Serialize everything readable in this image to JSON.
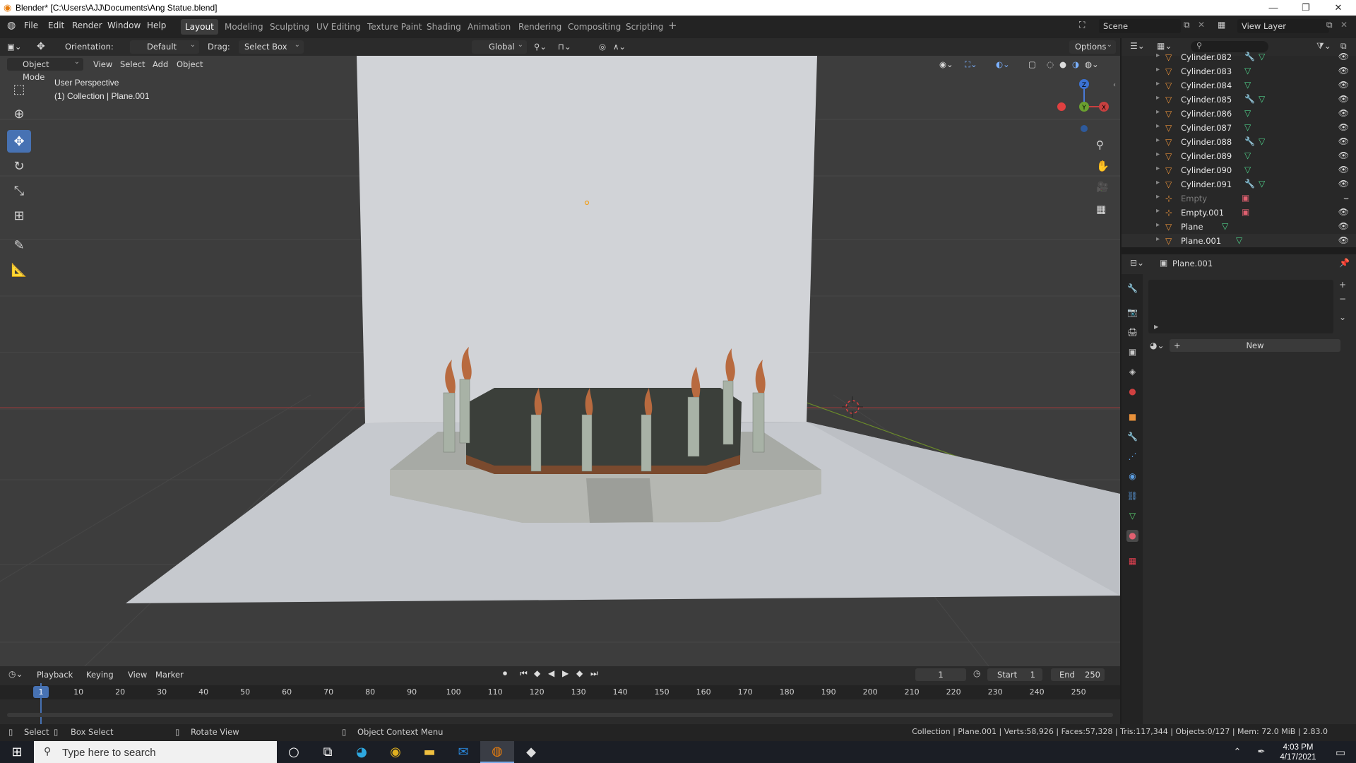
{
  "window": {
    "title": "Blender* [C:\\Users\\AJJ\\Documents\\Ang Statue.blend]"
  },
  "menu": [
    "File",
    "Edit",
    "Render",
    "Window",
    "Help"
  ],
  "workspaces": [
    "Layout",
    "Modeling",
    "Sculpting",
    "UV Editing",
    "Texture Paint",
    "Shading",
    "Animation",
    "Rendering",
    "Compositing",
    "Scripting"
  ],
  "scene": {
    "name": "Scene",
    "view_layer": "View Layer"
  },
  "toolsettings": {
    "orientation_label": "Orientation:",
    "orientation_value": "Default",
    "drag_label": "Drag:",
    "drag_value": "Select Box",
    "transform_orientation": "Global",
    "options": "Options"
  },
  "viewport": {
    "mode": "Object Mode",
    "menus": [
      "View",
      "Select",
      "Add",
      "Object"
    ],
    "perspective": "User Perspective",
    "collection_info": "(1) Collection | Plane.001",
    "gizmo_axes": [
      "Z",
      "Y",
      "X"
    ]
  },
  "outliner": {
    "items": [
      {
        "name": "Cylinder.082",
        "has_modifier": true,
        "dim": false
      },
      {
        "name": "Cylinder.083",
        "has_modifier": false,
        "dim": false
      },
      {
        "name": "Cylinder.084",
        "has_modifier": false,
        "dim": false
      },
      {
        "name": "Cylinder.085",
        "has_modifier": true,
        "dim": false
      },
      {
        "name": "Cylinder.086",
        "has_modifier": false,
        "dim": false
      },
      {
        "name": "Cylinder.087",
        "has_modifier": false,
        "dim": false
      },
      {
        "name": "Cylinder.088",
        "has_modifier": true,
        "dim": false
      },
      {
        "name": "Cylinder.089",
        "has_modifier": false,
        "dim": false
      },
      {
        "name": "Cylinder.090",
        "has_modifier": false,
        "dim": false
      },
      {
        "name": "Cylinder.091",
        "has_modifier": true,
        "dim": false
      },
      {
        "name": "Empty",
        "type": "empty",
        "dim": true
      },
      {
        "name": "Empty.001",
        "type": "empty",
        "dim": false
      },
      {
        "name": "Plane",
        "type": "mesh",
        "dim": false
      },
      {
        "name": "Plane.001",
        "type": "mesh",
        "dim": false
      }
    ]
  },
  "properties": {
    "object_name": "Plane.001",
    "new_button": "New"
  },
  "timeline": {
    "menus": [
      "Playback",
      "Keying",
      "View",
      "Marker"
    ],
    "current_frame": "1",
    "start_label": "Start",
    "start_value": "1",
    "end_label": "End",
    "end_value": "250",
    "ruler": [
      "1",
      "10",
      "20",
      "30",
      "40",
      "50",
      "60",
      "70",
      "80",
      "90",
      "100",
      "110",
      "120",
      "130",
      "140",
      "150",
      "160",
      "170",
      "180",
      "190",
      "200",
      "210",
      "220",
      "230",
      "240",
      "250"
    ]
  },
  "statusbar": {
    "select": "Select",
    "box_select": "Box Select",
    "rotate_view": "Rotate View",
    "context_menu": "Object Context Menu",
    "stats": "Collection | Plane.001 | Verts:58,926 | Faces:57,328 | Tris:117,344 | Objects:0/127 | Mem: 72.0 MiB | 2.83.0"
  },
  "taskbar": {
    "search_placeholder": "Type here to search",
    "time": "4:03 PM",
    "date": "4/17/2021"
  }
}
